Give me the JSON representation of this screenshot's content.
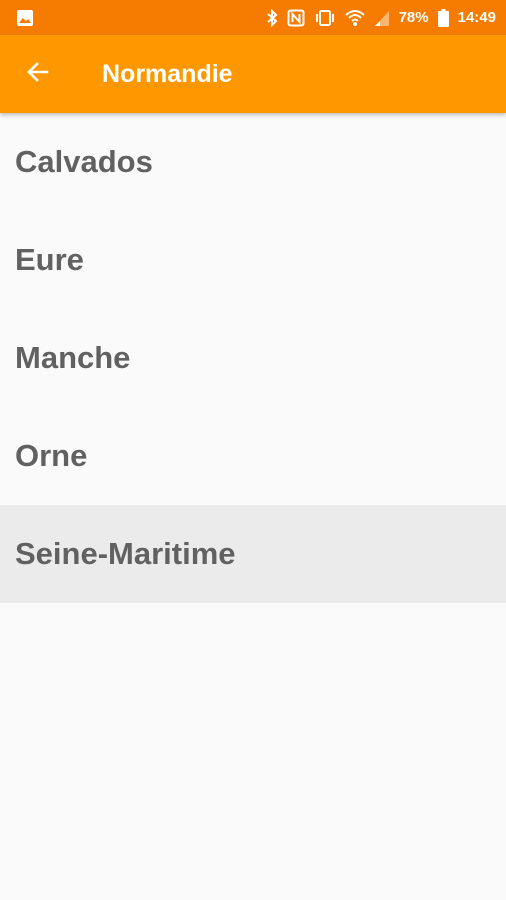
{
  "status_bar": {
    "battery": "78%",
    "time": "14:49",
    "icons": [
      "image-icon",
      "bluetooth-icon",
      "nfc-icon",
      "vibrate-icon",
      "wifi-icon",
      "signal-icon",
      "battery-icon"
    ]
  },
  "app_bar": {
    "back_icon": "arrow-back-icon",
    "title": "Normandie"
  },
  "list": {
    "items": [
      {
        "label": "Calvados"
      },
      {
        "label": "Eure"
      },
      {
        "label": "Manche"
      },
      {
        "label": "Orne"
      },
      {
        "label": "Seine-Maritime",
        "selected": true
      }
    ]
  },
  "colors": {
    "status_bar": "#f57c00",
    "app_bar": "#ff9800",
    "background": "#fafafa",
    "selected_row": "#ebebeb",
    "item_text": "#616161"
  }
}
